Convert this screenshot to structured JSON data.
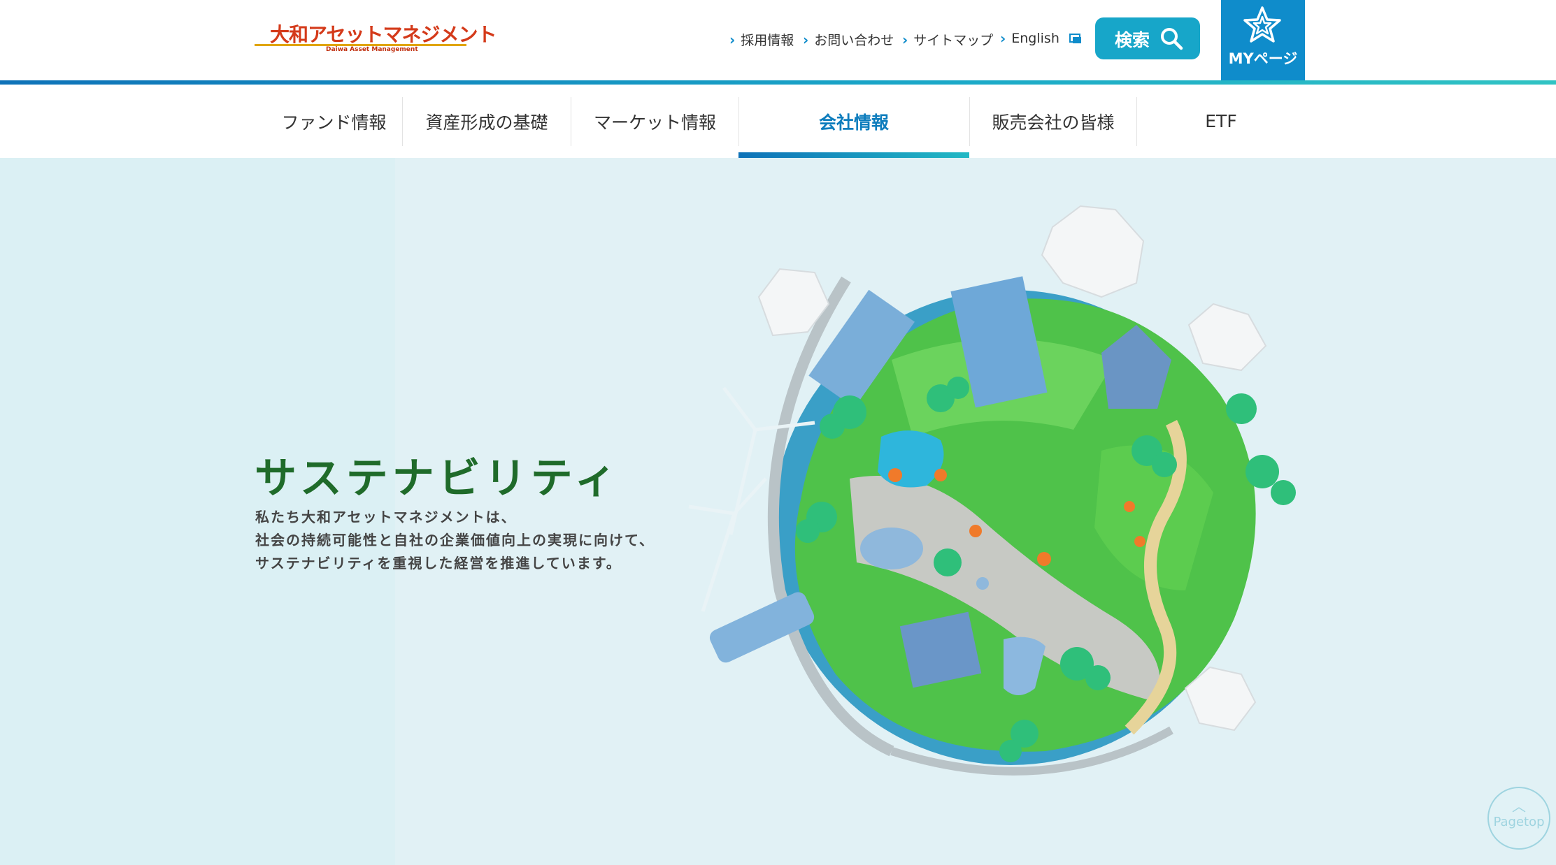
{
  "header": {
    "logo_text": "大和アセットマネジメント",
    "logo_sub": "Daiwa Asset Management",
    "util_links": [
      "採用情報",
      "お問い合わせ",
      "サイトマップ",
      "English"
    ],
    "search_label": "検索",
    "mypage_label": "MYページ"
  },
  "nav": {
    "items": [
      "ファンド情報",
      "資産形成の基礎",
      "マーケット情報",
      "会社情報",
      "販売会社の皆様",
      "ETF"
    ],
    "active": "会社情報"
  },
  "hero": {
    "title": "サステナビリティ",
    "lines": [
      "私たち大和アセットマネジメントは、",
      "社会の持続可能性と自社の企業価値向上の実現に向けて、",
      "サステナビリティを重視した経営を推進しています。"
    ]
  },
  "pagetop": {
    "label": "Pagetop"
  },
  "colors": {
    "brand_blue": "#0f8ccb",
    "search_teal": "#17a6c9",
    "title_green": "#1f6b2a",
    "logo_red": "#d43a1a"
  }
}
